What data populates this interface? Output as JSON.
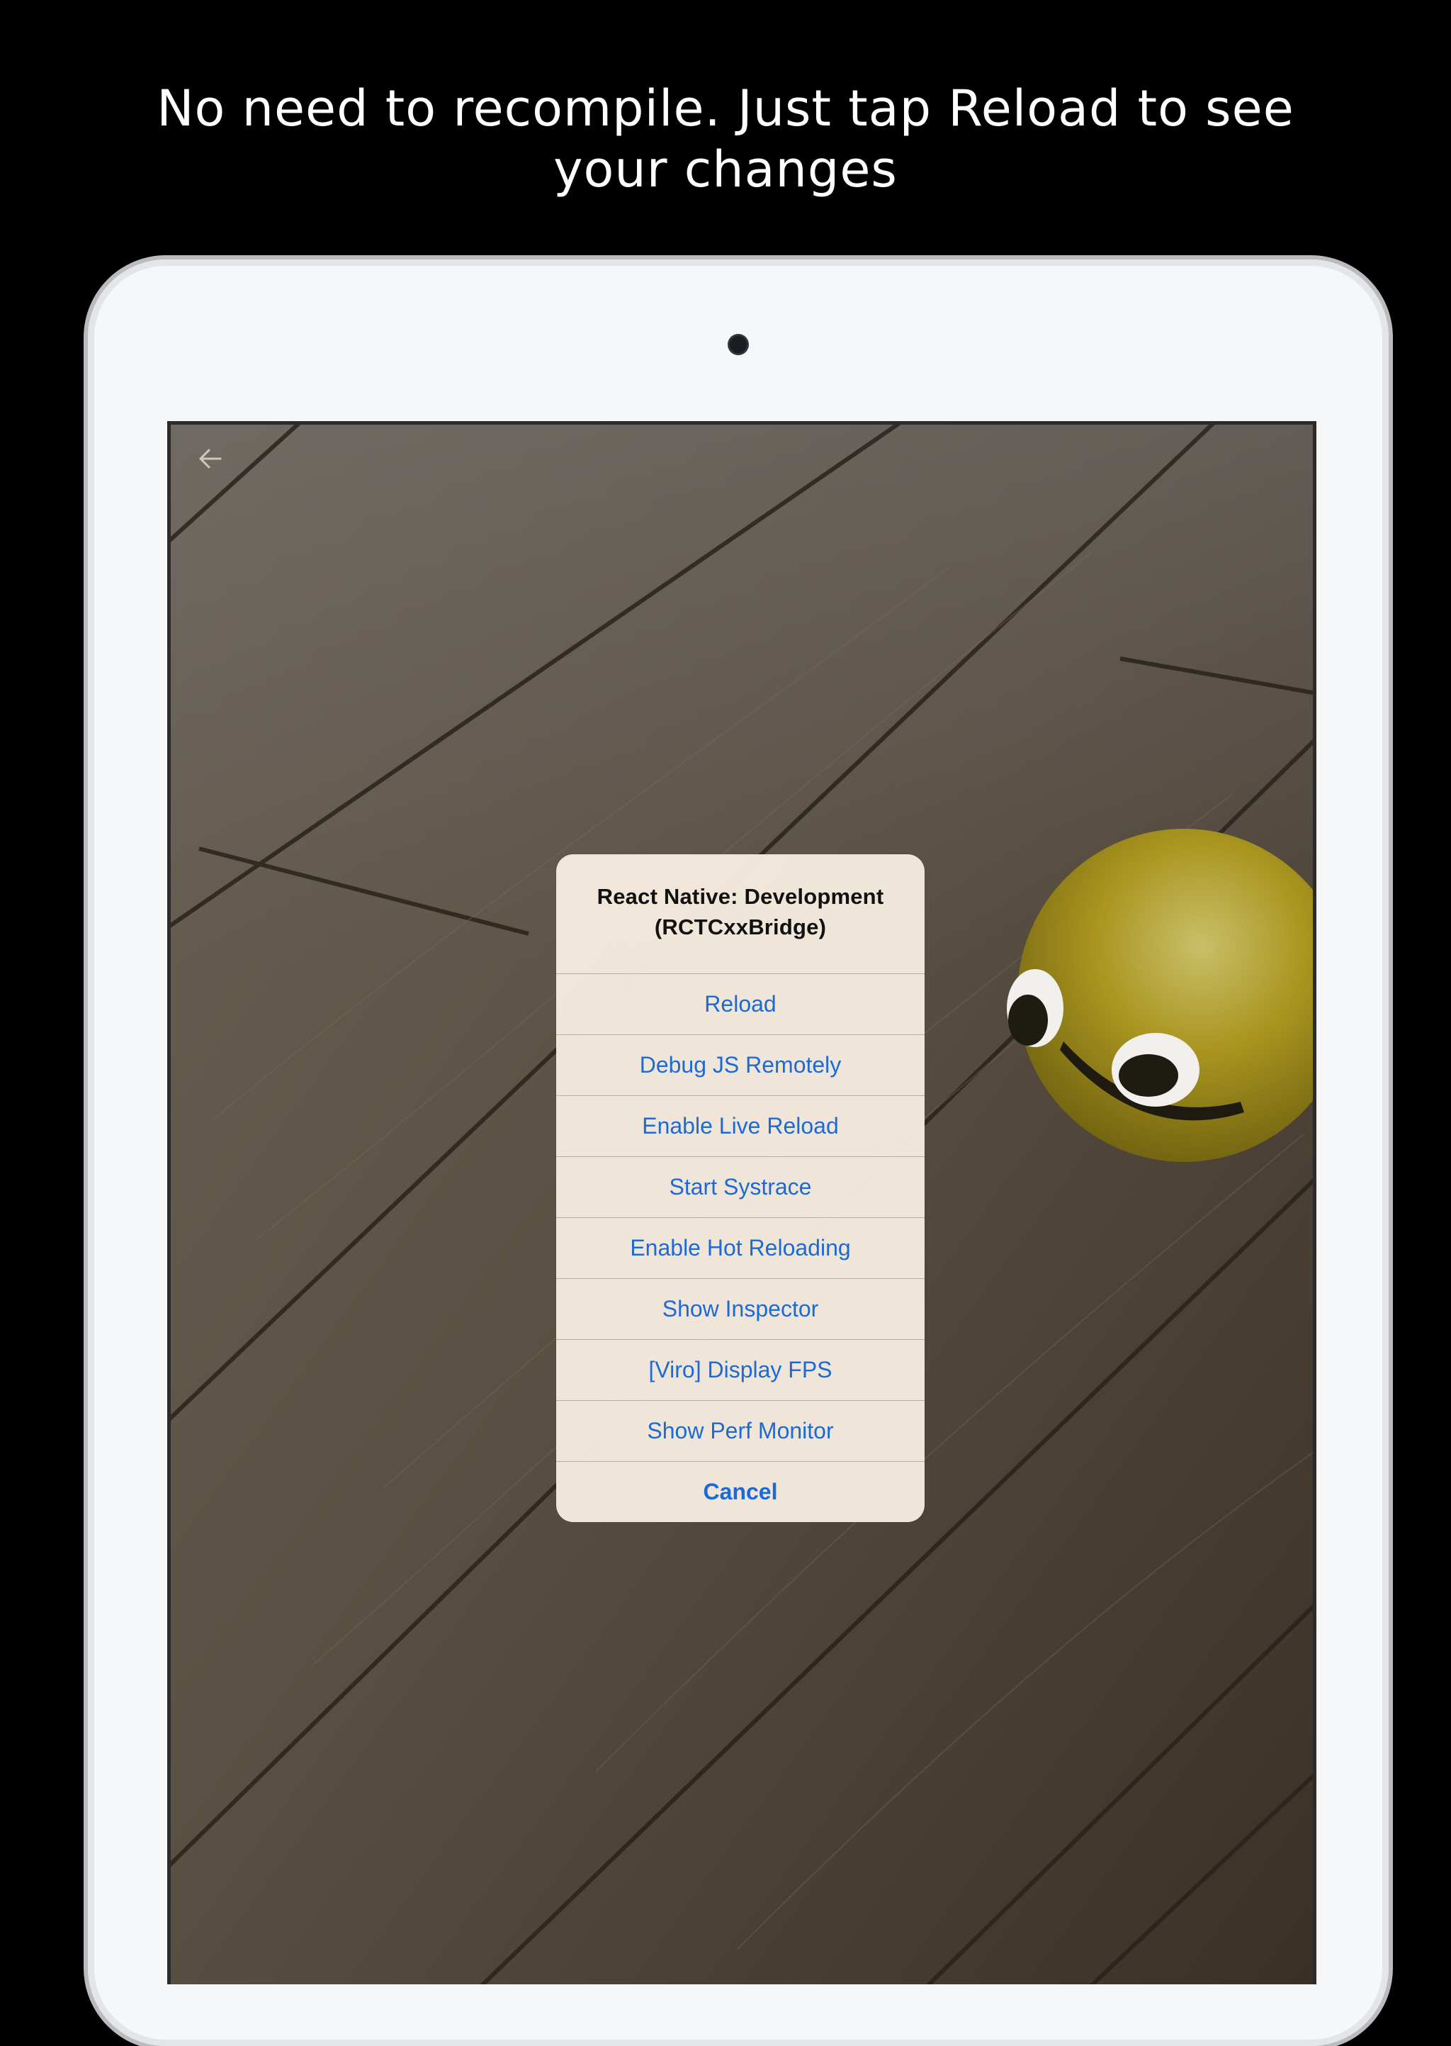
{
  "headline": {
    "line1": "No need to recompile. Just tap Reload to see",
    "line2": "your changes"
  },
  "app": {
    "back_icon": "back-arrow-icon"
  },
  "action_sheet": {
    "title_line1": "React Native: Development",
    "title_line2": "(RCTCxxBridge)",
    "items": [
      {
        "label": "Reload"
      },
      {
        "label": "Debug JS Remotely"
      },
      {
        "label": "Enable Live Reload"
      },
      {
        "label": "Start Systrace"
      },
      {
        "label": "Enable Hot Reloading"
      },
      {
        "label": "Show Inspector"
      },
      {
        "label": "[Viro] Display FPS"
      },
      {
        "label": "Show Perf Monitor"
      }
    ],
    "cancel_label": "Cancel",
    "accent_color": "#1d6ad6"
  }
}
